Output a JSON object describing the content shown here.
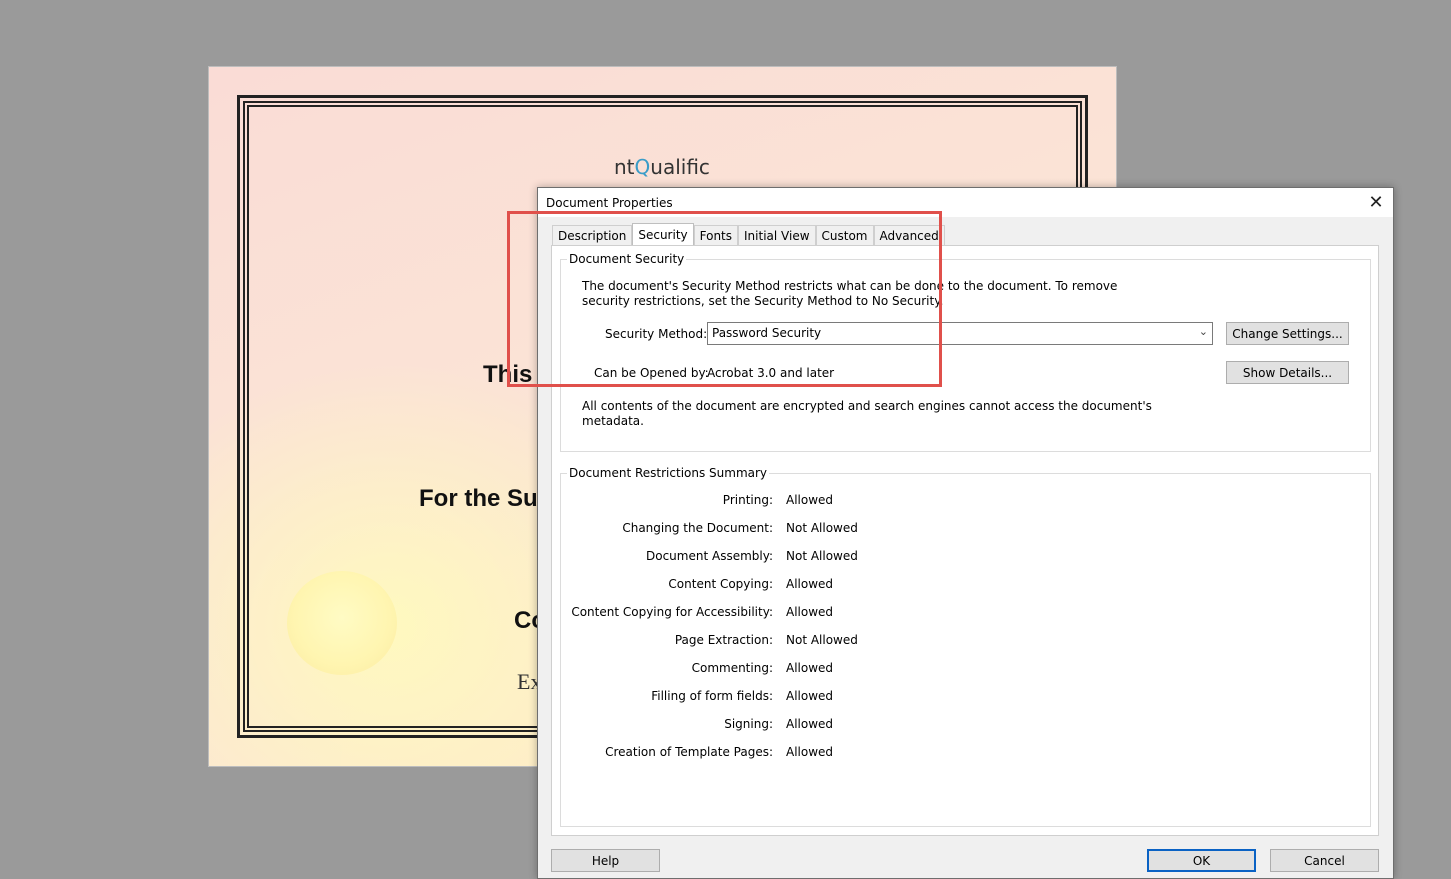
{
  "certificate": {
    "logo_text_1": "nt",
    "logo_text_q": "Q",
    "logo_text_2": "ualific",
    "line1": "This",
    "line2": "For the Su",
    "line3": "Co",
    "line4": "Ex"
  },
  "dialog": {
    "title": "Document Properties",
    "close_label": "✕",
    "tabs": [
      {
        "label": "Description"
      },
      {
        "label": "Security"
      },
      {
        "label": "Fonts"
      },
      {
        "label": "Initial View"
      },
      {
        "label": "Custom"
      },
      {
        "label": "Advanced"
      }
    ],
    "security": {
      "group_title": "Document Security",
      "intro_line1": "The document's Security Method restricts what can be done to the document. To remove",
      "intro_line2": "security restrictions, set the Security Method to No Security.",
      "method_label": "Security Method:",
      "method_value": "Password Security",
      "change_settings": "Change Settings...",
      "opened_label": "Can be Opened by:",
      "opened_value": "Acrobat 3.0 and later",
      "show_details": "Show Details...",
      "encrypted_line1": "All contents of the document are encrypted and search engines cannot access the document's",
      "encrypted_line2": "metadata."
    },
    "restrictions": {
      "group_title": "Document Restrictions Summary",
      "rows": [
        {
          "label": "Printing:",
          "value": "Allowed"
        },
        {
          "label": "Changing the Document:",
          "value": "Not Allowed"
        },
        {
          "label": "Document Assembly:",
          "value": "Not Allowed"
        },
        {
          "label": "Content Copying:",
          "value": "Allowed"
        },
        {
          "label": "Content Copying for Accessibility:",
          "value": "Allowed"
        },
        {
          "label": "Page Extraction:",
          "value": "Not Allowed"
        },
        {
          "label": "Commenting:",
          "value": "Allowed"
        },
        {
          "label": "Filling of form fields:",
          "value": "Allowed"
        },
        {
          "label": "Signing:",
          "value": "Allowed"
        },
        {
          "label": "Creation of Template Pages:",
          "value": "Allowed"
        }
      ]
    },
    "buttons": {
      "help": "Help",
      "ok": "OK",
      "cancel": "Cancel"
    }
  },
  "colors": {
    "highlight": "#e0504b",
    "ok_border": "#0a62c4"
  }
}
